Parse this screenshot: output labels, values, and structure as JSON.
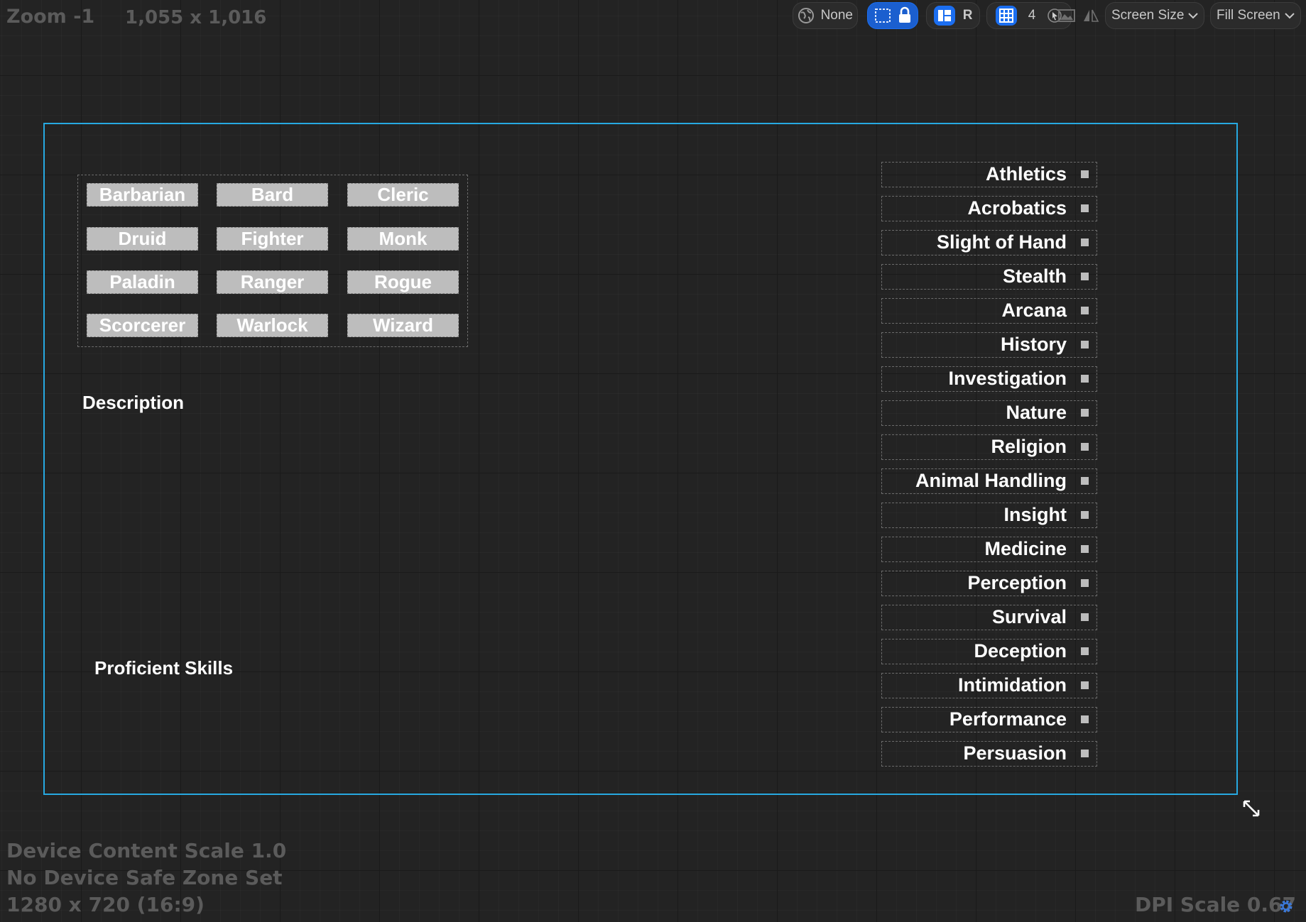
{
  "info": {
    "zoom": "Zoom -1",
    "dimensions": "1,055 x 1,016",
    "device_content_scale": "Device Content Scale 1.0",
    "safe_zone": "No Device Safe Zone Set",
    "resolution": "1280 x 720 (16:9)",
    "dpi_scale": "DPI Scale 0.67"
  },
  "toolbar": {
    "localization_value": "None",
    "respect_locks_label": "R",
    "grid_snap_value": "4",
    "screen_size_label": "Screen Size",
    "fill_screen_label": "Fill Screen",
    "accent_color": "#1b6ef0"
  },
  "classes": [
    "Barbarian",
    "Bard",
    "Cleric",
    "Druid",
    "Fighter",
    "Monk",
    "Paladin",
    "Ranger",
    "Rogue",
    "Scorcerer",
    "Warlock",
    "Wizard"
  ],
  "labels": {
    "description": "Description",
    "proficient_skills": "Proficient Skills"
  },
  "skills": [
    "Athletics",
    "Acrobatics",
    "Slight of Hand",
    "Stealth",
    "Arcana",
    "History",
    "Investigation",
    "Nature",
    "Religion",
    "Animal Handling",
    "Insight",
    "Medicine",
    "Perception",
    "Survival",
    "Deception",
    "Intimidation",
    "Performance",
    "Persuasion"
  ],
  "colors": {
    "frame_border": "#27a9e1",
    "button_fill": "#bdbdbd",
    "background": "#232323"
  }
}
